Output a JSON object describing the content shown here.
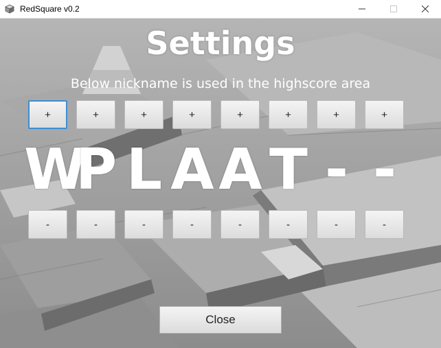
{
  "window": {
    "title": "RedSquare v0.2",
    "icon": "app-cube-icon",
    "controls": [
      "minimize-icon",
      "maximize-icon",
      "close-icon"
    ]
  },
  "settings": {
    "heading": "Settings",
    "subheading": "Below nickname is used in the highscore area",
    "plus_label": "+",
    "minus_label": "-",
    "nickname_letters": [
      "W",
      "P",
      "L",
      "A",
      "A",
      "T",
      "-",
      "-"
    ],
    "close_label": "Close"
  },
  "colors": {
    "focus_border": "#3c8ed3",
    "heading_text": "#ffffff"
  }
}
